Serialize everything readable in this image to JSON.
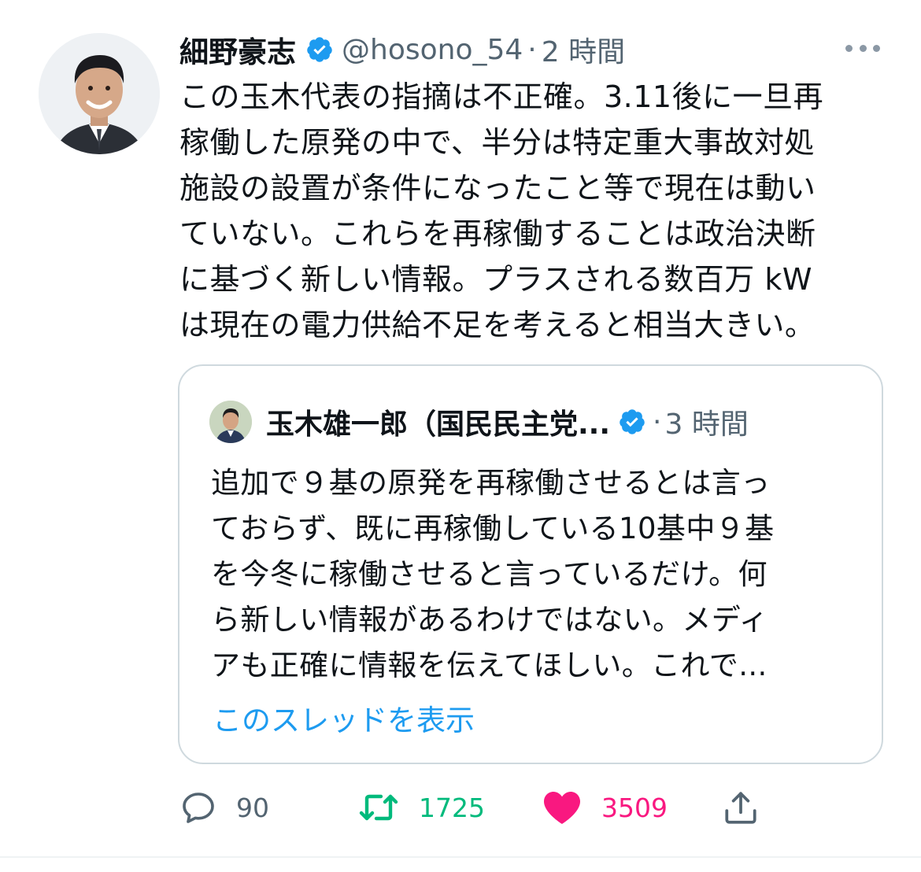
{
  "tweet": {
    "author": {
      "display_name": "細野豪志",
      "handle": "@hosono_54",
      "verified": true
    },
    "separator": "·",
    "time": "2 時間",
    "text": "この玉木代表の指摘は不正確。3.11後に一旦再\n稼働した原発の中で、半分は特定重大事故対処\n施設の設置が条件になったこと等で現在は動い\nていない。これらを再稼働することは政治決断\nに基づく新しい情報。プラスされる数百万 kW\nは現在の電力供給不足を考えると相当大きい。",
    "quoted": {
      "display_name": "玉木雄一郎（国民民主党...",
      "verified": true,
      "separator": "·",
      "time": "3 時間",
      "text": "追加で９基の原発を再稼働させるとは言っ\nておらず、既に再稼働している10基中９基\nを今冬に稼働させると言っているだけ。何\nら新しい情報があるわけではない。メディ\nアも正確に情報を伝えてほしい。これで...",
      "show_thread": "このスレッドを表示"
    },
    "actions": {
      "replies": "90",
      "retweets": "1725",
      "likes": "3509"
    }
  },
  "colors": {
    "verified_badge": "#1d9bf0",
    "secondary_text": "#536471",
    "retweet": "#00ba7c",
    "like": "#f91880",
    "link": "#1d9bf0"
  },
  "icons": {
    "reply": "reply-icon",
    "retweet": "retweet-icon",
    "like": "heart-icon",
    "share": "share-icon",
    "more": "more-icon",
    "verified": "verified-badge-icon"
  }
}
